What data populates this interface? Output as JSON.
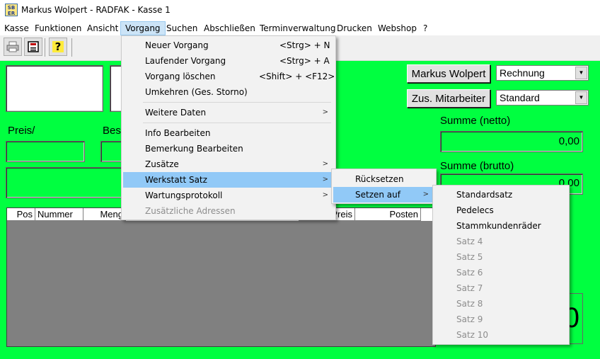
{
  "window": {
    "title": "Markus Wolpert - RADFAK - Kasse 1",
    "icon": "SB app icon"
  },
  "menubar": [
    "Kasse",
    "Funktionen",
    "Ansicht",
    "Vorgang",
    "Suchen",
    "Abschließen",
    "Terminverwaltung",
    "Drucken",
    "Webshop",
    "?"
  ],
  "toolbar": {
    "icons": [
      "printer-icon",
      "save-icon",
      "help-icon"
    ],
    "help_glyph": "?"
  },
  "form": {
    "preis_label": "Preis/",
    "bes_label": "Bes",
    "employee_button": "Markus Wolpert",
    "doc_type": "Rechnung",
    "zus_button": "Zus. Mitarbeiter",
    "price_level": "Standard",
    "summe_netto_label": "Summe (netto)",
    "summe_netto_value": "0,00",
    "summe_brutto_label": "Summe (brutto)",
    "summe_brutto_value": "0,00",
    "big_total": "0"
  },
  "grid": {
    "columns": [
      "Pos",
      "Nummer",
      "Meng",
      "Preis",
      "Posten"
    ]
  },
  "vorgang_menu": {
    "items": [
      {
        "label": "Neuer Vorgang",
        "shortcut": "<Strg> + N"
      },
      {
        "label": "Laufender Vorgang",
        "shortcut": "<Strg> + A"
      },
      {
        "label": "Vorgang löschen",
        "shortcut": "<Shift> + <F12>"
      },
      {
        "label": "Umkehren (Ges. Storno)",
        "shortcut": ""
      },
      {
        "label": "Weitere Daten",
        "shortcut": ""
      },
      {
        "label": "Info Bearbeiten",
        "shortcut": ""
      },
      {
        "label": "Bemerkung Bearbeiten",
        "shortcut": ""
      },
      {
        "label": "Zusätze",
        "shortcut": ""
      },
      {
        "label": "Werkstatt Satz",
        "shortcut": ""
      },
      {
        "label": "Wartungsprotokoll",
        "shortcut": ""
      },
      {
        "label": "Zusätzliche Adressen",
        "shortcut": ""
      }
    ],
    "submenu_arrow": ">"
  },
  "werkstatt_menu": {
    "items": [
      "Rücksetzen",
      "Setzen auf"
    ]
  },
  "setzen_menu": {
    "items": [
      "Standardsatz",
      "Pedelecs",
      "Stammkundenräder",
      "Satz 4",
      "Satz 5",
      "Satz 6",
      "Satz 7",
      "Satz 8",
      "Satz 9",
      "Satz 10"
    ]
  },
  "colors": {
    "workspace": "#00ff40",
    "menu_highlight": "#91c9f7",
    "menubar_active": "#cce4f7"
  }
}
